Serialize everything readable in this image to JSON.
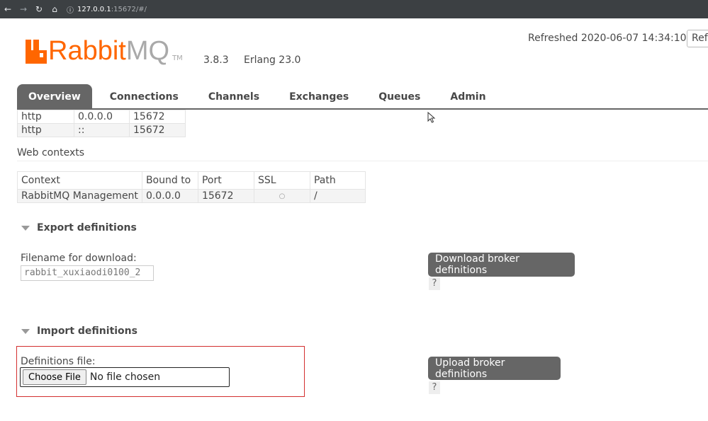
{
  "browser": {
    "back_icon": "arrow-left-icon",
    "forward_icon": "arrow-right-icon",
    "reload_icon": "reload-icon",
    "home_icon": "home-icon",
    "url_host": "127.0.0.1",
    "url_rest": ":15672/#/"
  },
  "header": {
    "logo_rabbit": "Rabbit",
    "logo_mq": "MQ",
    "logo_tm": "TM",
    "version": "3.8.3",
    "erlang": "Erlang 23.0",
    "refreshed": "Refreshed 2020-06-07 14:34:10",
    "refresh_button": "Refresh"
  },
  "tabs": [
    {
      "label": "Overview",
      "active": true
    },
    {
      "label": "Connections"
    },
    {
      "label": "Channels"
    },
    {
      "label": "Exchanges"
    },
    {
      "label": "Queues"
    },
    {
      "label": "Admin"
    }
  ],
  "listeners": {
    "rows": [
      [
        "http",
        "0.0.0.0",
        "15672"
      ],
      [
        "http",
        "::",
        "15672"
      ]
    ]
  },
  "web_contexts": {
    "title": "Web contexts",
    "headers": [
      "Context",
      "Bound to",
      "Port",
      "SSL",
      "Path"
    ],
    "rows": [
      [
        "RabbitMQ Management",
        "0.0.0.0",
        "15672",
        "○",
        "/"
      ]
    ]
  },
  "export": {
    "title": "Export definitions",
    "filename_label": "Filename for download:",
    "filename_value": "rabbit_xuxiaodi0100_2",
    "button": "Download broker definitions",
    "help": "?"
  },
  "import": {
    "title": "Import definitions",
    "file_label": "Definitions file:",
    "choose_button": "Choose File",
    "no_file": "No file chosen",
    "button": "Upload broker definitions",
    "help": "?"
  },
  "colors": {
    "brand_orange": "#ff6600",
    "tab_gray": "#666666",
    "highlight_red": "#d32f2f"
  }
}
